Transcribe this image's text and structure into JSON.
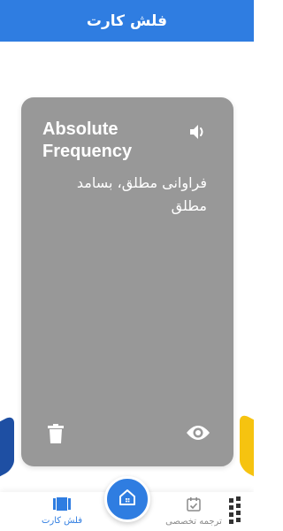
{
  "header": {
    "title": "فلش کارت"
  },
  "card": {
    "term": "Absolute Frequency",
    "translation": "فراوانی مطلق، بسامد مطلق",
    "speaker_icon": "speaker-icon",
    "delete_icon": "trash-icon",
    "reveal_icon": "eye-icon"
  },
  "bottom_nav": {
    "items": [
      {
        "label": "فلش کارت",
        "icon": "cards-icon",
        "active": true
      },
      {
        "label": "ترجمه تخصصی",
        "icon": "calendar-check-icon",
        "active": false
      }
    ],
    "home_icon": "home-icon"
  },
  "colors": {
    "primary": "#2f7de1",
    "card": "#989898",
    "accent_yellow": "#f6c310",
    "accent_navy": "#1e4fa3"
  }
}
